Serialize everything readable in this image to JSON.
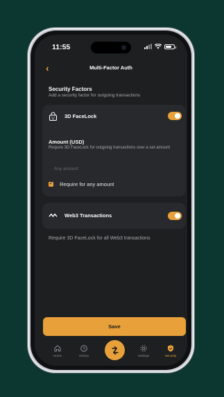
{
  "status_bar": {
    "time": "11:55"
  },
  "header": {
    "back_icon": "chevron-left-icon",
    "title": "Multi-Factor Auth"
  },
  "security": {
    "title": "Security Factors",
    "subtitle": "Add a security factor for outgoing transactions"
  },
  "facelock": {
    "icon": "face-lock-icon",
    "label": "3D FaceLock",
    "enabled": true,
    "amount_title": "Amount (USD)",
    "amount_description": "Require 3D FaceLock for outgoing transactions over a set amount",
    "amount_placeholder": "Any amount",
    "require_any_label": "Require for any amount",
    "require_any_checked": true
  },
  "web3": {
    "icon": "web3-icon",
    "label": "Web3 Transactions",
    "enabled": true,
    "description": "Require 3D FaceLock for all Web3 transactions"
  },
  "save_label": "Save",
  "tabs": [
    {
      "label": "Home",
      "icon": "home-icon"
    },
    {
      "label": "History",
      "icon": "clock-icon"
    },
    {
      "label": "",
      "icon": "swap-icon"
    },
    {
      "label": "Settings",
      "icon": "gear-icon"
    },
    {
      "label": "Security",
      "icon": "shield-icon",
      "active": true
    }
  ],
  "colors": {
    "accent": "#e8a13a",
    "background": "#0c3731",
    "screen": "#1e1f21",
    "card": "#28292c"
  }
}
